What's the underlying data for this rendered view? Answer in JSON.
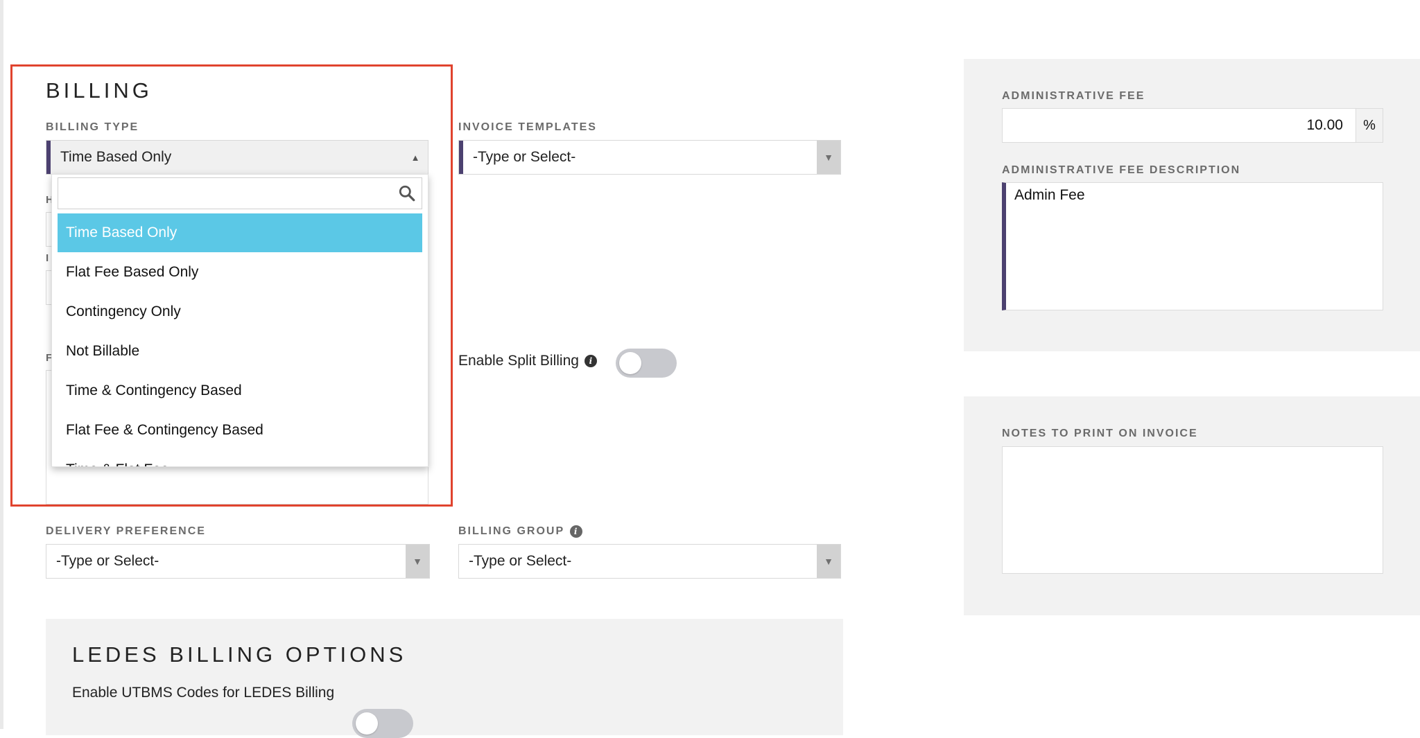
{
  "billing": {
    "title": "BILLING",
    "billing_type": {
      "label": "BILLING TYPE",
      "value": "Time Based Only",
      "search_placeholder": "",
      "options": [
        "Time Based Only",
        "Flat Fee Based Only",
        "Contingency Only",
        "Not Billable",
        "Time & Contingency Based",
        "Flat Fee & Contingency Based",
        "Time & Flat Fee"
      ]
    },
    "invoice_templates": {
      "label": "INVOICE TEMPLATES",
      "value": "-Type or Select-"
    },
    "split_billing": {
      "label": "Enable Split Billing",
      "enabled": false
    },
    "delivery_preference": {
      "label": "DELIVERY PREFERENCE",
      "value": "-Type or Select-"
    },
    "billing_group": {
      "label": "BILLING GROUP",
      "value": "-Type or Select-"
    },
    "hidden_field_letters": [
      "H",
      "I",
      "F"
    ]
  },
  "ledes": {
    "title": "LEDES BILLING OPTIONS",
    "utbms_label": "Enable UTBMS Codes for LEDES Billing",
    "utbms_enabled": false
  },
  "admin_fee": {
    "label": "ADMINISTRATIVE FEE",
    "value": "10.00",
    "unit": "%",
    "description_label": "ADMINISTRATIVE FEE DESCRIPTION",
    "description_value": "Admin Fee"
  },
  "notes": {
    "label": "NOTES TO PRINT ON INVOICE",
    "value": ""
  },
  "colors": {
    "accent": "#4c4170",
    "selected_option": "#5bc8e6",
    "highlight_border": "#e0432e",
    "panel_bg": "#f2f2f2"
  }
}
